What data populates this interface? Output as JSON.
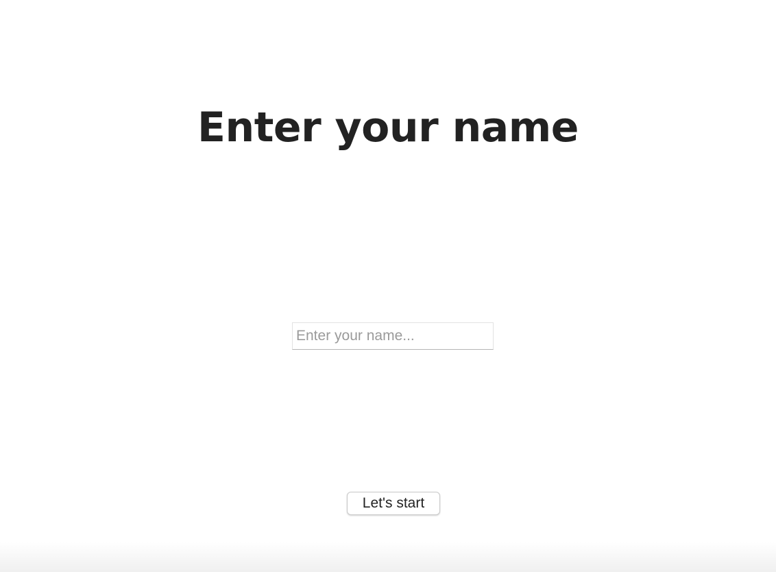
{
  "title": "Enter your name",
  "name_input": {
    "value": "",
    "placeholder": "Enter your name..."
  },
  "start_button": {
    "label": "Let's start"
  }
}
